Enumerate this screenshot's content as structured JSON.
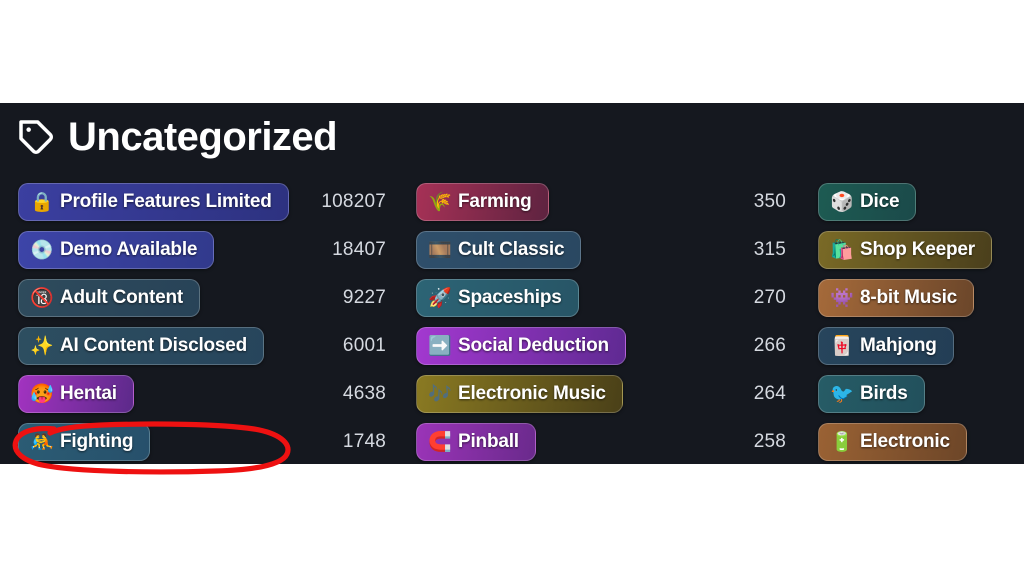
{
  "header": {
    "title": "Uncategorized",
    "icon": "tag-icon"
  },
  "columns": [
    {
      "name": "column-1",
      "rows": [
        {
          "label": "Profile Features Limited",
          "emoji": "🔒",
          "icon_name": "lock-icon",
          "count": "108207",
          "bg_from": "#3b3fa0",
          "bg_to": "#2d3280"
        },
        {
          "label": "Demo Available",
          "emoji": "💿",
          "icon_name": "optical-disk-icon",
          "count": "18407",
          "bg_from": "#3d44a8",
          "bg_to": "#313a8c"
        },
        {
          "label": "Adult Content",
          "emoji": "🔞",
          "icon_name": "no-one-under-eighteen-icon",
          "count": "9227",
          "bg_from": "#2e4b5c",
          "bg_to": "#284358"
        },
        {
          "label": "AI Content Disclosed",
          "emoji": "✨",
          "icon_name": "sparkles-icon",
          "count": "6001",
          "bg_from": "#2d4e60",
          "bg_to": "#27455c",
          "annotated": true
        },
        {
          "label": "Hentai",
          "emoji": "🥵",
          "icon_name": "hot-face-icon",
          "count": "4638",
          "bg_from": "#a233c0",
          "bg_to": "#5c2a8a"
        },
        {
          "label": "Fighting",
          "emoji": "🤼",
          "icon_name": "wrestlers-icon",
          "count": "1748",
          "bg_from": "#2b5c74",
          "bg_to": "#27506b"
        }
      ]
    },
    {
      "name": "column-2",
      "rows": [
        {
          "label": "Farming",
          "emoji": "🌾",
          "icon_name": "sheaf-of-rice-icon",
          "count": "350",
          "bg_from": "#a63156",
          "bg_to": "#5e2340"
        },
        {
          "label": "Cult Classic",
          "emoji": "🎞️",
          "icon_name": "film-frames-icon",
          "count": "315",
          "bg_from": "#2f4f6b",
          "bg_to": "#2a4861"
        },
        {
          "label": "Spaceships",
          "emoji": "🚀",
          "icon_name": "rocket-icon",
          "count": "270",
          "bg_from": "#2c6475",
          "bg_to": "#275566"
        },
        {
          "label": "Social Deduction",
          "emoji": "➡️",
          "icon_name": "arrow-right-icon",
          "count": "266",
          "bg_from": "#a338d0",
          "bg_to": "#5f2a92"
        },
        {
          "label": "Electronic Music",
          "emoji": "🎶",
          "icon_name": "musical-notes-icon",
          "count": "264",
          "bg_from": "#8a7a22",
          "bg_to": "#4a4018"
        },
        {
          "label": "Pinball",
          "emoji": "🧲",
          "icon_name": "magnet-icon",
          "count": "258",
          "bg_from": "#9b34b8",
          "bg_to": "#6a2a8c"
        }
      ]
    },
    {
      "name": "column-3",
      "rows": [
        {
          "label": "Dice",
          "emoji": "🎲",
          "icon_name": "game-die-icon",
          "count": "",
          "bg_from": "#1d5b52",
          "bg_to": "#1b4a4a"
        },
        {
          "label": "Shop Keeper",
          "emoji": "🛍️",
          "icon_name": "shopping-bags-icon",
          "count": "",
          "bg_from": "#7a6a26",
          "bg_to": "#4a3f1c"
        },
        {
          "label": "8-bit Music",
          "emoji": "👾",
          "icon_name": "alien-monster-icon",
          "count": "",
          "bg_from": "#a56a3a",
          "bg_to": "#6b462a"
        },
        {
          "label": "Mahjong",
          "emoji": "🀄",
          "icon_name": "mahjong-tile-icon",
          "count": "",
          "bg_from": "#27455c",
          "bg_to": "#233e55"
        },
        {
          "label": "Birds",
          "emoji": "🐦",
          "icon_name": "bird-icon",
          "count": "",
          "bg_from": "#265c66",
          "bg_to": "#22505c"
        },
        {
          "label": "Electronic",
          "emoji": "🔋",
          "icon_name": "battery-icon",
          "count": "",
          "bg_from": "#9a6234",
          "bg_to": "#6d4628"
        }
      ]
    }
  ],
  "annotation": {
    "name": "red-highlight-circle",
    "color": "#ee1111",
    "target": "AI Content Disclosed"
  },
  "colors": {
    "panel_bg": "#15181f",
    "page_bg": "#ffffff",
    "text": "#ffffff",
    "count_text": "#d5d9e0"
  }
}
